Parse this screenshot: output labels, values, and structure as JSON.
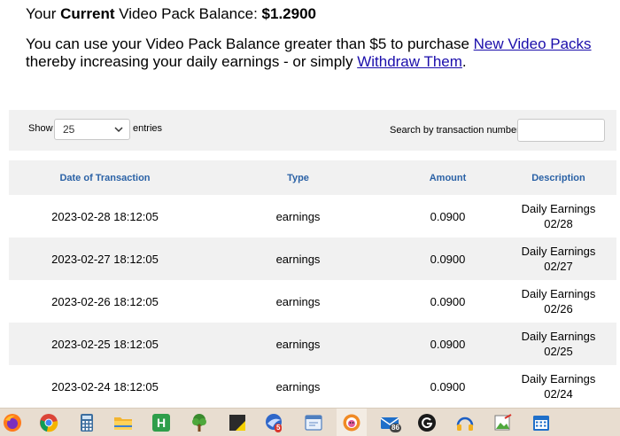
{
  "balance": {
    "prefix": "Your",
    "bold_word": "Current",
    "middle": "Video Pack Balance:",
    "amount": "$1.2900"
  },
  "info": {
    "text_1": "You can use your Video Pack Balance greater than $5 to purchase",
    "link_1": "New Video Packs",
    "text_2": "thereby increasing your daily earnings - or simply",
    "link_2": "Withdraw Them",
    "text_3": "."
  },
  "controls": {
    "show_label": "Show",
    "entries_value": "25",
    "entries_label": "entries",
    "search_label": "Search by transaction number:",
    "search_value": ""
  },
  "table": {
    "columns": [
      "Date of Transaction",
      "Type",
      "Amount",
      "Description"
    ],
    "rows": [
      {
        "date": "2023-02-28 18:12:05",
        "type": "earnings",
        "amount": "0.0900",
        "desc_1": "Daily Earnings",
        "desc_2": "02/28"
      },
      {
        "date": "2023-02-27 18:12:05",
        "type": "earnings",
        "amount": "0.0900",
        "desc_1": "Daily Earnings",
        "desc_2": "02/27"
      },
      {
        "date": "2023-02-26 18:12:05",
        "type": "earnings",
        "amount": "0.0900",
        "desc_1": "Daily Earnings",
        "desc_2": "02/26"
      },
      {
        "date": "2023-02-25 18:12:05",
        "type": "earnings",
        "amount": "0.0900",
        "desc_1": "Daily Earnings",
        "desc_2": "02/25"
      },
      {
        "date": "2023-02-24 18:12:05",
        "type": "earnings",
        "amount": "0.0900",
        "desc_1": "Daily Earnings",
        "desc_2": "02/24"
      }
    ]
  },
  "taskbar": {
    "icons": [
      "firefox-icon",
      "chrome-icon",
      "calculator-icon",
      "file-explorer-icon",
      "h-app-icon",
      "tree-app-icon",
      "sticky-notes-icon",
      "mail-client-icon",
      "window-app-icon",
      "browser-profile-icon",
      "mail-icon",
      "g-app-icon",
      "headphones-app-icon",
      "image-editor-icon",
      "calendar-icon"
    ],
    "badge_mail_client": "5",
    "badge_mail": "86"
  },
  "colors": {
    "link": "#1a0dab",
    "header_text": "#2b62a6",
    "stripe": "#f1f1f1",
    "taskbar": "#e8ddd0"
  }
}
